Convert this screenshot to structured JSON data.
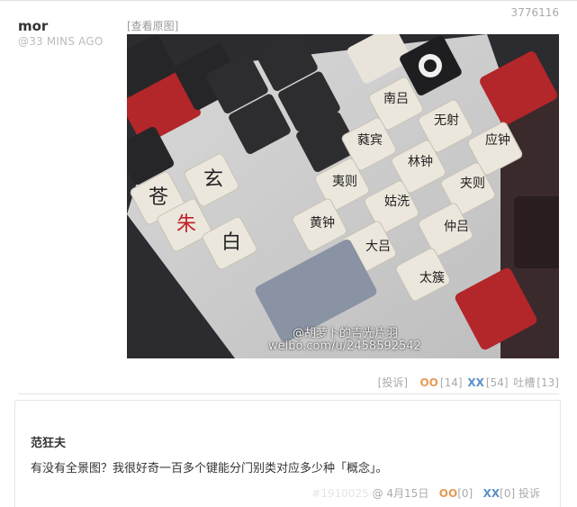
{
  "post": {
    "id": "3776116",
    "author": "mor",
    "time": "@33 MINS AGO",
    "view_original": "[查看原图]",
    "image": {
      "alt": "Keyboard with Chinese character keycaps",
      "watermark_line1": "@胡萝卜的吉光片羽",
      "watermark_line2": "weibo.com/u/2458592542",
      "keycaps": [
        "太簇",
        "仲吕",
        "夹则",
        "应钟",
        "无射",
        "大吕",
        "姑洗",
        "林钟",
        "蕤宾",
        "南吕",
        "夷则",
        "黄钟",
        "玄",
        "苍",
        "朱",
        "白"
      ]
    },
    "actions": {
      "report": "[投诉]",
      "oo_label": "OO",
      "oo_count": "[14]",
      "xx_label": "XX",
      "xx_count": "[54]",
      "tucao_label": "吐槽",
      "tucao_count": "[13]"
    }
  },
  "comment": {
    "author": "范狂夫",
    "text": "有没有全景图？我很好奇一百多个键能分门别类对应多少种「概念」。",
    "hash": "#1910025",
    "date": "@ 4月15日",
    "oo_label": "OO",
    "oo_count": "[0]",
    "xx_label": "XX",
    "xx_count": "[0]",
    "report": "投诉"
  },
  "colors": {
    "oo": "#e89a57",
    "xx": "#5b8fc7",
    "muted": "#aaaaaa"
  }
}
